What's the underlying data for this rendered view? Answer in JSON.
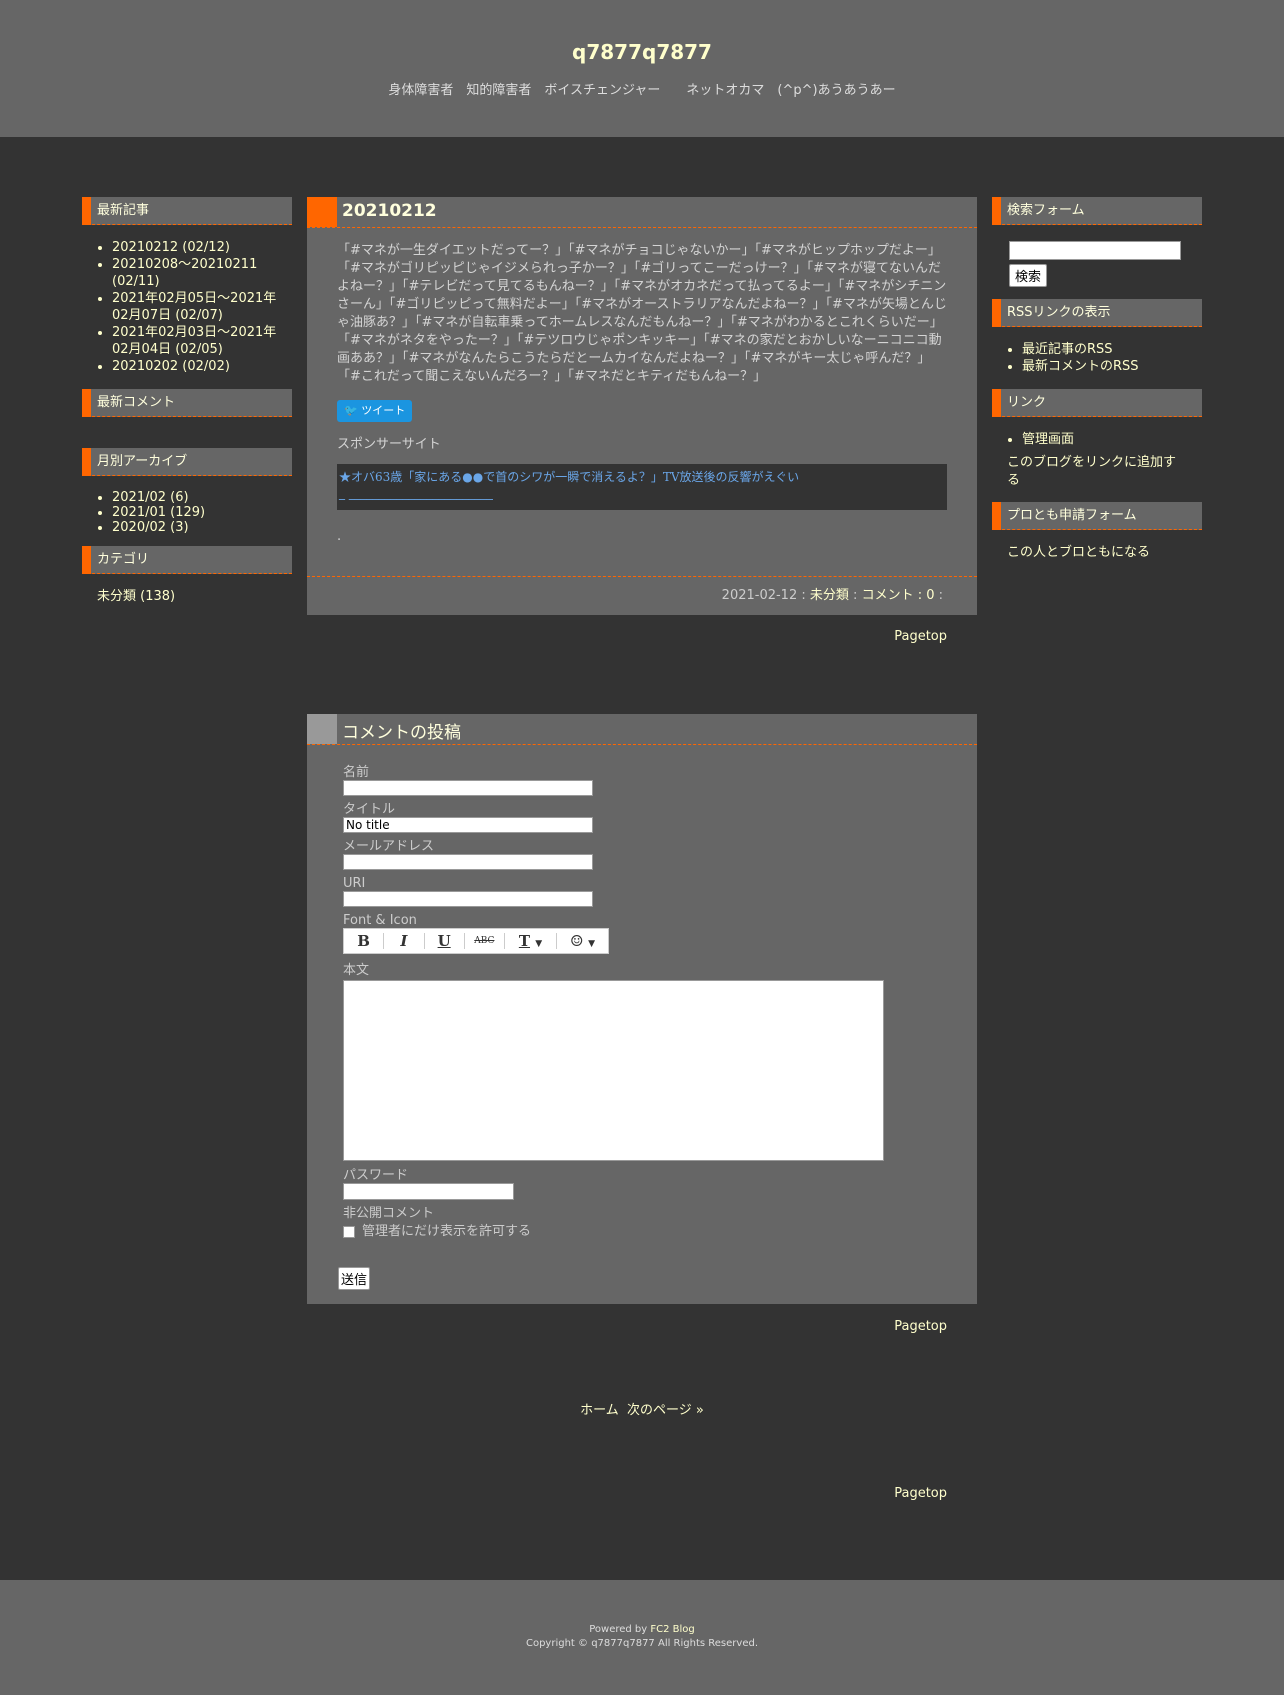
{
  "header": {
    "title": "q7877q7877",
    "description": "身体障害者　知的障害者　ボイスチェンジャー　　ネットオカマ　(^p^)あうあうあー"
  },
  "left_sidebar": {
    "recent_title": "最新記事",
    "recent_items": [
      "20210212 (02/12)",
      "20210208～20210211 (02/11)",
      "2021年02月05日～2021年02月07日 (02/07)",
      "2021年02月03日～2021年02月04日 (02/05)",
      "20210202 (02/02)"
    ],
    "comments_title": "最新コメント",
    "archive_title": "月別アーカイブ",
    "archive_items": [
      "2021/02 (6)",
      "2021/01 (129)",
      "2020/02 (3)"
    ],
    "category_title": "カテゴリ",
    "category_item": "未分類 (138)"
  },
  "right_sidebar": {
    "search_title": "検索フォーム",
    "search_button": "検索",
    "rss_title": "RSSリンクの表示",
    "rss_items": [
      "最近記事のRSS",
      "最新コメントのRSS"
    ],
    "link_title": "リンク",
    "link_items": [
      "管理画面"
    ],
    "link_add": "このブログをリンクに追加する",
    "profriend_title": "プロとも申請フォーム",
    "profriend_link": "この人とブロともになる"
  },
  "entry": {
    "title": "20210212",
    "body": "「#マネが一生ダイエットだってー？」「#マネがチョコじゃないかー」「#マネがヒップホップだよー」「#マネがゴリピッピじゃイジメられっ子かー？」「#ゴリってこーだっけー？」「#マネが寝てないんだよねー？」「#テレビだって見てるもんねー？」「#マネがオカネだって払ってるよー」「#マネがシチニンさーん」「#ゴリピッピって無料だよー」「#マネがオーストラリアなんだよねー？」「#マネが矢場とんじゃ油豚あ？」「#マネが自転車乗ってホームレスなんだもんねー？」「#マネがわかるとこれくらいだー」「#マネがネタをやったー？」「#テツロウじゃポンキッキー」「#マネの家だとおかしいなーニコニコ動画ああ？」「#マネがなんたらこうたらだとームカイなんだよねー？」「#マネがキー太じゃ呼んだ？」「#これだって聞こえないんだろー？」「#マネだとキティだもんねー？」",
    "tweet": "ツイート",
    "sponsor_label": "スポンサーサイト",
    "ad_text": "★オバ63歳「家にある●●で首のシワが一瞬で消えるよ？」TV放送後の反響がえぐい",
    "ad_sub": "_ ________________________",
    "dot": ".",
    "date": "2021-02-12",
    "sep": " : ",
    "category": "未分類",
    "comment_label": "コメント : 0",
    "trail": " :"
  },
  "pagetop": "Pagetop",
  "comment_form": {
    "title": "コメントの投稿",
    "name_label": "名前",
    "title_label": "タイトル",
    "title_value": "No title",
    "mail_label": "メールアドレス",
    "url_label": "URI",
    "font_label": "Font & Icon",
    "body_label": "本文",
    "password_label": "パスワード",
    "secret_label": "非公開コメント",
    "secret_check": "管理者にだけ表示を許可する",
    "submit": "送信"
  },
  "pager": {
    "home": "ホーム",
    "next": "次のページ »"
  },
  "footer": {
    "powered": "Powered by ",
    "fc2": "FC2 Blog",
    "copyright": "Copyright © q7877q7877 All Rights Reserved."
  },
  "colors": {
    "accent": "#ff6600",
    "panel": "#666666",
    "background": "#333333",
    "link": "#ffffcc"
  }
}
